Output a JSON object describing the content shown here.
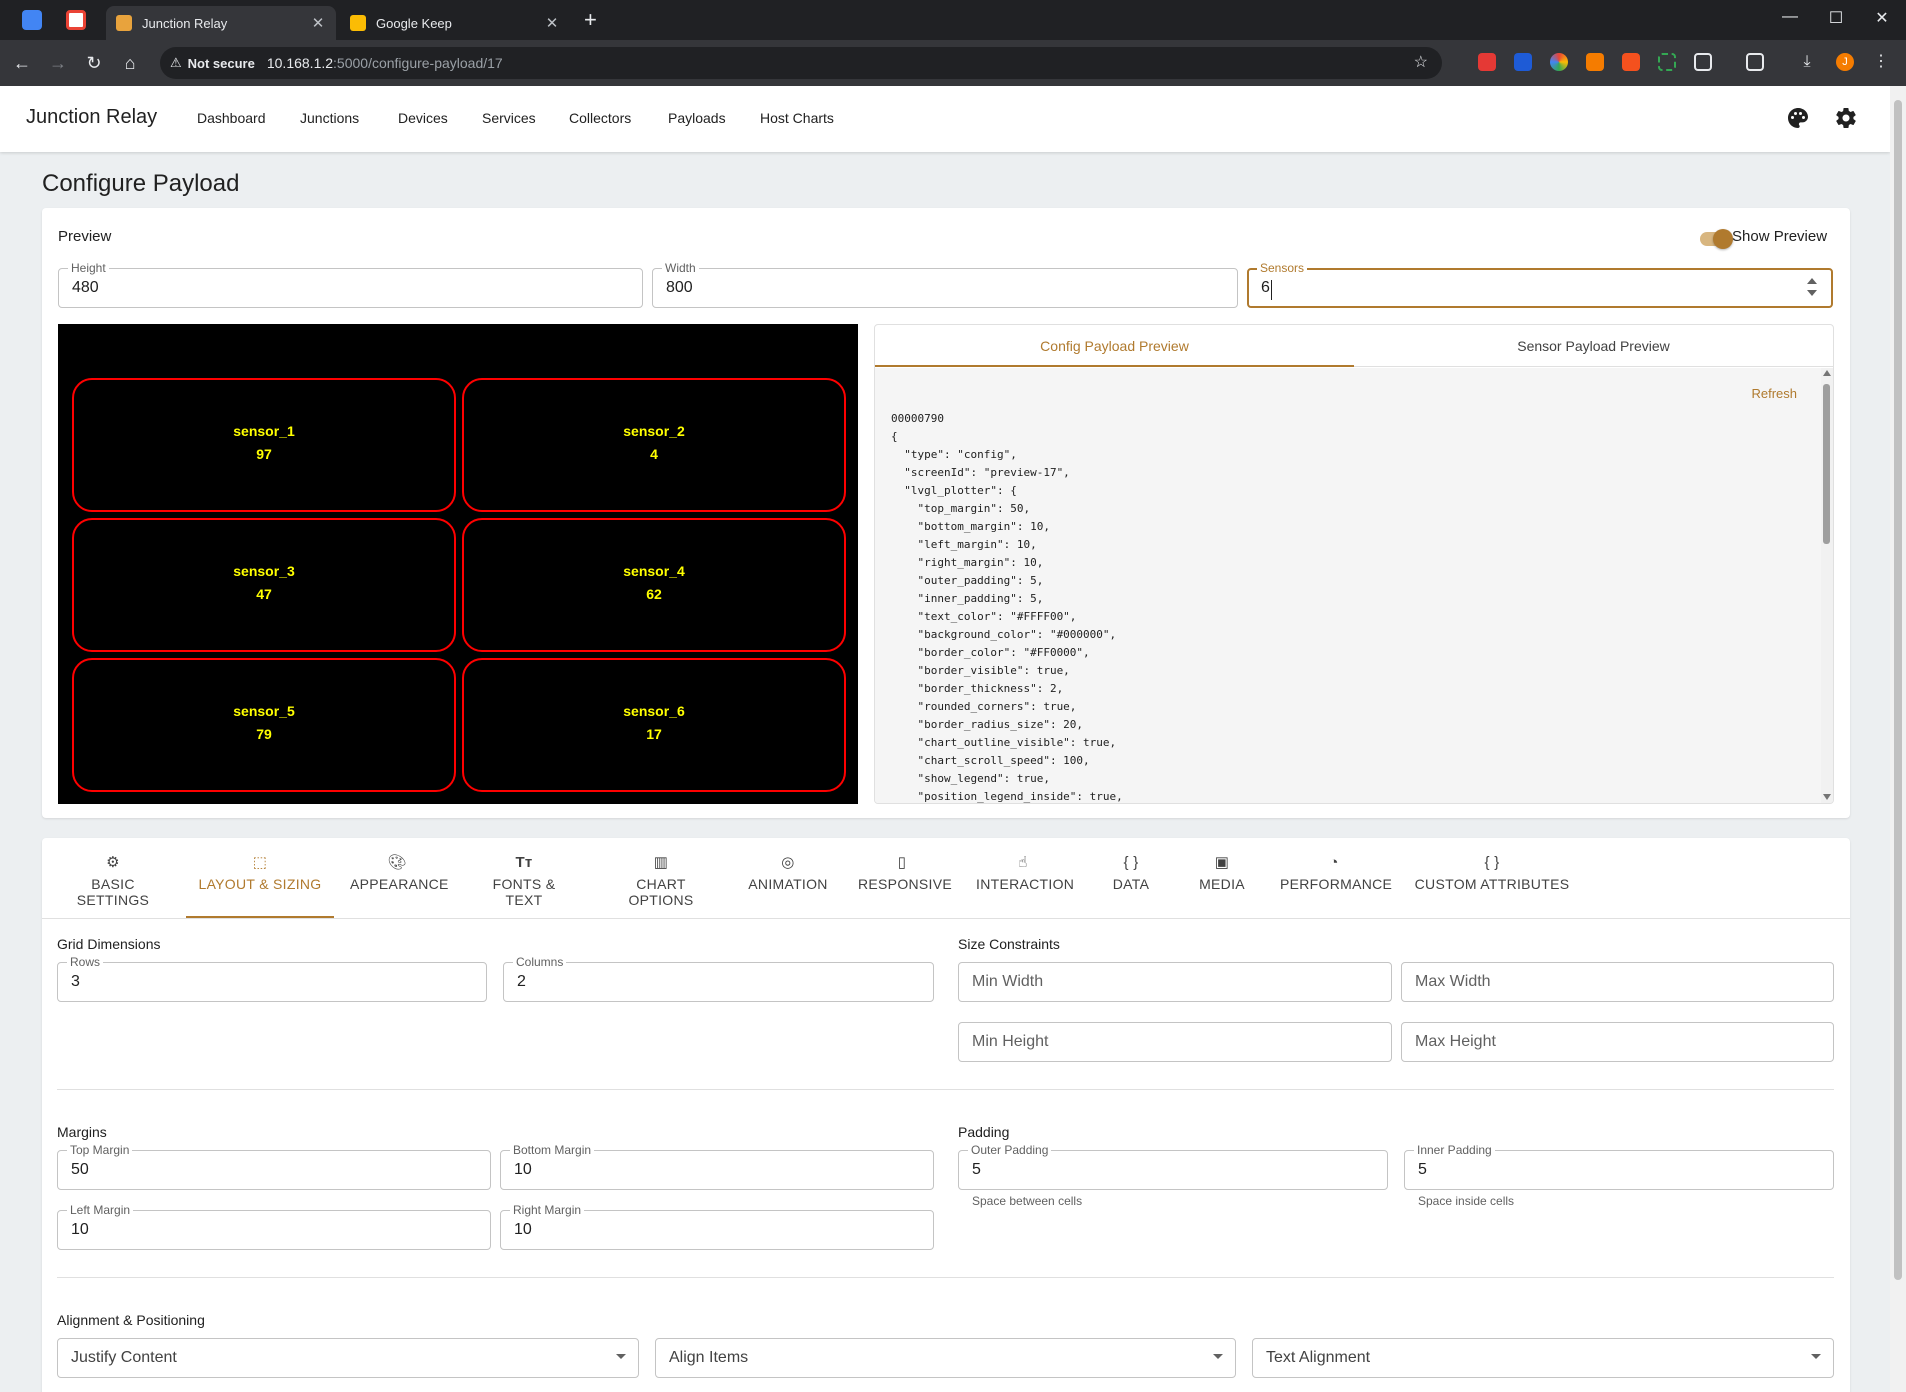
{
  "browser": {
    "tabs": [
      {
        "title": "Junction Relay",
        "active": true
      },
      {
        "title": "Google Keep",
        "active": false
      }
    ],
    "address": {
      "warning": "Not secure",
      "host": "10.168.1.2",
      "path": ":5000/configure-payload/17"
    }
  },
  "app": {
    "brand": "Junction Relay",
    "nav": [
      "Dashboard",
      "Junctions",
      "Devices",
      "Services",
      "Collectors",
      "Payloads",
      "Host Charts"
    ],
    "page_title": "Configure Payload"
  },
  "preview": {
    "heading": "Preview",
    "toggle_label": "Show Preview",
    "height": {
      "label": "Height",
      "value": "480"
    },
    "width": {
      "label": "Width",
      "value": "800"
    },
    "sensors": {
      "label": "Sensors",
      "value": "6"
    },
    "canvas": {
      "background": "#000000",
      "border_color": "#FF0000",
      "text_color": "#FFFF00",
      "cells": [
        {
          "name": "sensor_1",
          "value": "97"
        },
        {
          "name": "sensor_2",
          "value": "4"
        },
        {
          "name": "sensor_3",
          "value": "47"
        },
        {
          "name": "sensor_4",
          "value": "62"
        },
        {
          "name": "sensor_5",
          "value": "79"
        },
        {
          "name": "sensor_6",
          "value": "17"
        }
      ]
    },
    "payload_tabs": {
      "config": "Config Payload Preview",
      "sensor": "Sensor Payload Preview"
    },
    "refresh": "Refresh",
    "code": "00000790\n{\n  \"type\": \"config\",\n  \"screenId\": \"preview-17\",\n  \"lvgl_plotter\": {\n    \"top_margin\": 50,\n    \"bottom_margin\": 10,\n    \"left_margin\": 10,\n    \"right_margin\": 10,\n    \"outer_padding\": 5,\n    \"inner_padding\": 5,\n    \"text_color\": \"#FFFF00\",\n    \"background_color\": \"#000000\",\n    \"border_color\": \"#FF0000\",\n    \"border_visible\": true,\n    \"border_thickness\": 2,\n    \"rounded_corners\": true,\n    \"border_radius_size\": 20,\n    \"chart_outline_visible\": true,\n    \"chart_scroll_speed\": 100,\n    \"show_legend\": true,\n    \"position_legend_inside\": true,"
  },
  "settings_tabs": [
    {
      "label": "BASIC SETTINGS",
      "icon": "gear-icon"
    },
    {
      "label": "LAYOUT & SIZING",
      "icon": "aspect-ratio-icon"
    },
    {
      "label": "APPEARANCE",
      "icon": "palette-icon"
    },
    {
      "label": "FONTS & TEXT",
      "icon": "text-size-icon"
    },
    {
      "label": "CHART OPTIONS",
      "icon": "bar-chart-icon"
    },
    {
      "label": "ANIMATION",
      "icon": "animation-icon"
    },
    {
      "label": "RESPONSIVE",
      "icon": "phone-icon"
    },
    {
      "label": "INTERACTION",
      "icon": "touch-icon"
    },
    {
      "label": "DATA",
      "icon": "braces-icon"
    },
    {
      "label": "MEDIA",
      "icon": "image-icon"
    },
    {
      "label": "PERFORMANCE",
      "icon": "speedometer-icon"
    },
    {
      "label": "CUSTOM ATTRIBUTES",
      "icon": "braces-icon"
    }
  ],
  "active_settings_tab": "LAYOUT & SIZING",
  "layout": {
    "grid": {
      "heading": "Grid Dimensions",
      "rows": {
        "label": "Rows",
        "value": "3"
      },
      "columns": {
        "label": "Columns",
        "value": "2"
      }
    },
    "size": {
      "heading": "Size Constraints",
      "min_width": "Min Width",
      "max_width": "Max Width",
      "min_height": "Min Height",
      "max_height": "Max Height"
    },
    "margins": {
      "heading": "Margins",
      "top": {
        "label": "Top Margin",
        "value": "50"
      },
      "bottom": {
        "label": "Bottom Margin",
        "value": "10"
      },
      "left": {
        "label": "Left Margin",
        "value": "10"
      },
      "right": {
        "label": "Right Margin",
        "value": "10"
      }
    },
    "padding": {
      "heading": "Padding",
      "outer": {
        "label": "Outer Padding",
        "value": "5",
        "helper": "Space between cells"
      },
      "inner": {
        "label": "Inner Padding",
        "value": "5",
        "helper": "Space inside cells"
      }
    },
    "alignment": {
      "heading": "Alignment & Positioning",
      "justify": "Justify Content",
      "align": "Align Items",
      "text": "Text Alignment"
    }
  },
  "colors": {
    "accent": "#B07A2E"
  }
}
